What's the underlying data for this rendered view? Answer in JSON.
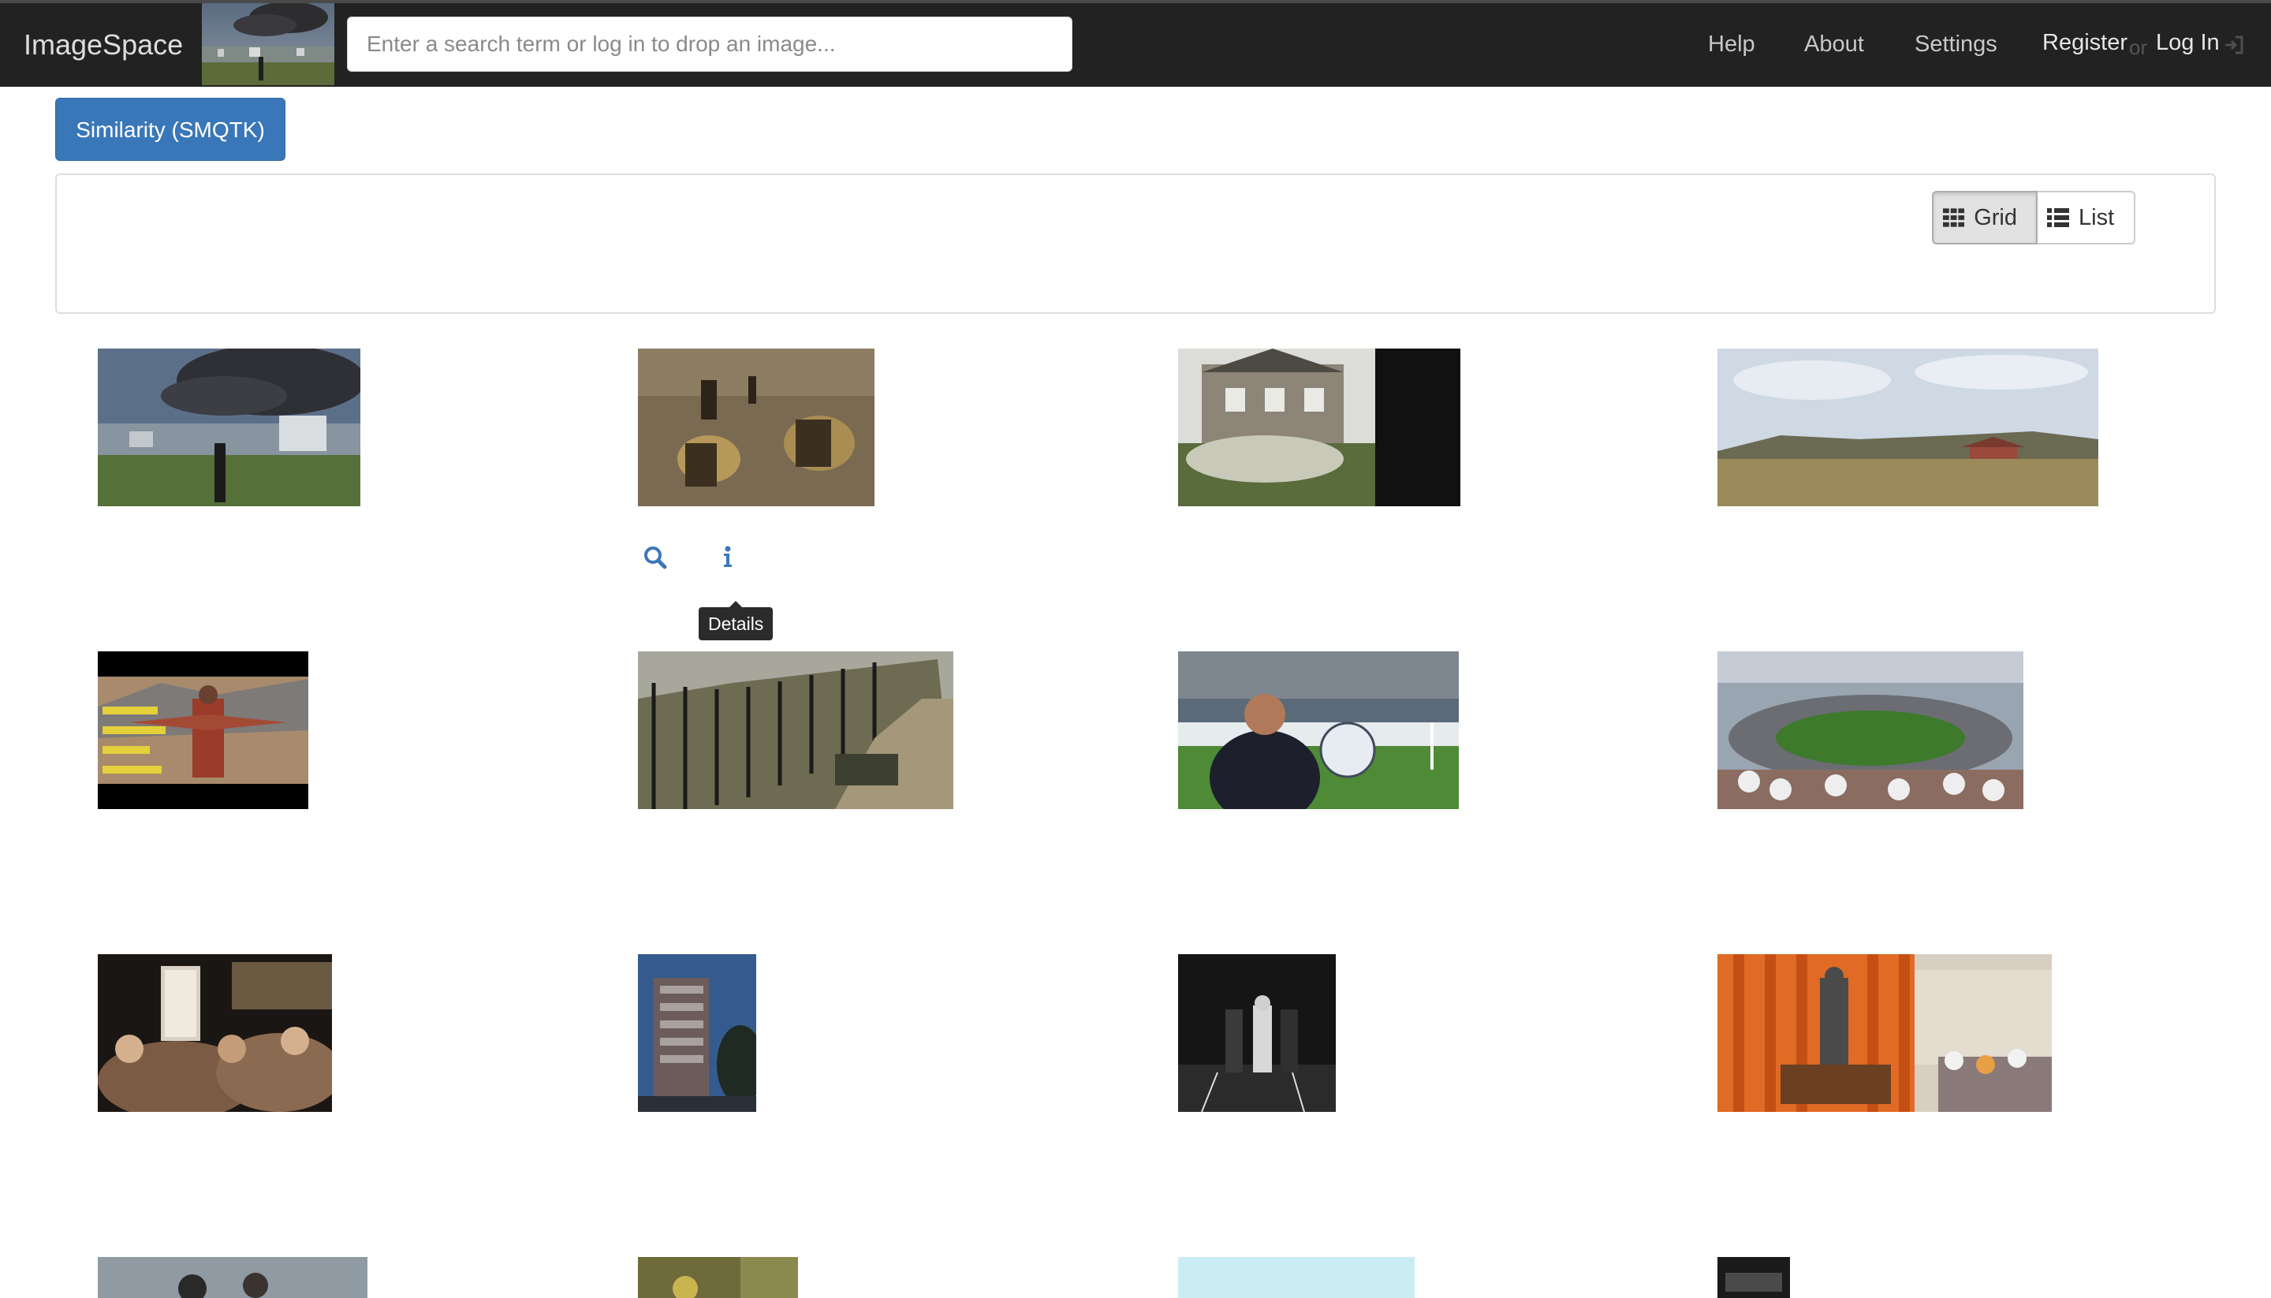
{
  "navbar": {
    "brand": "ImageSpace",
    "search_placeholder": "Enter a search term or log in to drop an image...",
    "links": {
      "help": "Help",
      "about": "About",
      "settings": "Settings",
      "register": "Register",
      "or": "or",
      "login": "Log In"
    },
    "login_icon": "sign-in-icon"
  },
  "toolbar": {
    "similarity_label": "Similarity (SMQTK)",
    "view_modes": [
      {
        "label": "Grid",
        "icon": "th-icon",
        "active": true
      },
      {
        "label": "List",
        "icon": "list-icon",
        "active": false
      }
    ]
  },
  "image_actions": {
    "search_icon": "search-icon",
    "info_icon": "info-icon",
    "tooltip": "Details"
  },
  "colors": {
    "navbar_bg": "#222222",
    "primary": "#3a77b8",
    "link": "#3a77b8"
  }
}
